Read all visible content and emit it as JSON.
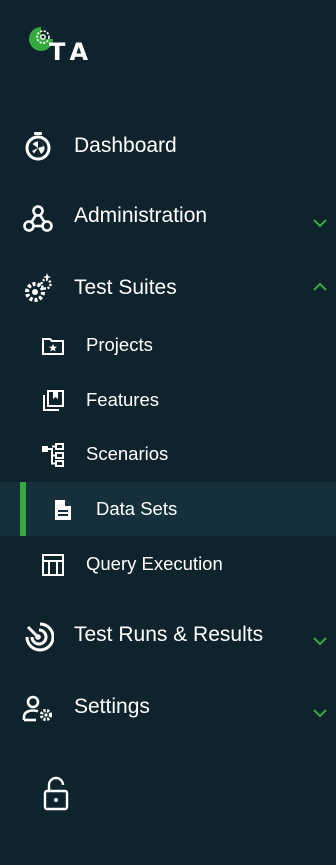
{
  "logo": {
    "letters": "TA"
  },
  "colors": {
    "background": "#0f232d",
    "accent": "#35a83e",
    "active_bg": "#15303a",
    "text": "#ffffff"
  },
  "menu": {
    "dashboard": {
      "label": "Dashboard",
      "icon": "stopwatch-icon"
    },
    "administration": {
      "label": "Administration",
      "icon": "webhook-icon",
      "expanded": false
    },
    "test_suites": {
      "label": "Test Suites",
      "icon": "gears-sparkle-icon",
      "expanded": true,
      "children": [
        {
          "label": "Projects",
          "icon": "folder-star-icon"
        },
        {
          "label": "Features",
          "icon": "collections-bookmark-icon"
        },
        {
          "label": "Scenarios",
          "icon": "account-tree-icon"
        },
        {
          "label": "Data Sets",
          "icon": "document-icon",
          "active": true
        },
        {
          "label": "Query Execution",
          "icon": "table-layout-icon"
        }
      ]
    },
    "test_runs": {
      "label": "Test Runs & Results",
      "icon": "radar-target-icon",
      "expanded": false
    },
    "settings": {
      "label": "Settings",
      "icon": "user-gear-icon",
      "expanded": false
    }
  },
  "footer": {
    "lock_icon": "lock-open-icon"
  }
}
